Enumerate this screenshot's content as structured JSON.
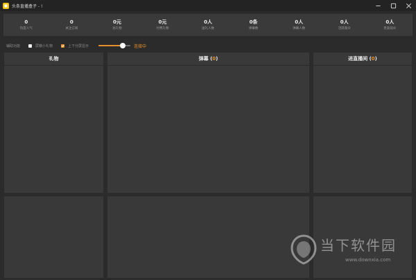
{
  "window": {
    "title": "头条直播盒子 - !"
  },
  "stats": [
    {
      "value": "0",
      "label": "热度人气"
    },
    {
      "value": "0",
      "label": "关注订阅"
    },
    {
      "value": "0元",
      "label": "总礼物"
    },
    {
      "value": "0元",
      "label": "付费礼物"
    },
    {
      "value": "0人",
      "label": "送礼人数"
    },
    {
      "value": "0条",
      "label": "弹幕数"
    },
    {
      "value": "0人",
      "label": "弹幕人数"
    },
    {
      "value": "0人",
      "label": "活跃观众"
    },
    {
      "value": "0人",
      "label": "贵族观众"
    }
  ],
  "options": {
    "assist_label": "辅助功能",
    "block_small_gift": {
      "label": "屏蔽小礼物",
      "checked": false
    },
    "split_display": {
      "label": "上下分屏显示",
      "checked": true
    },
    "slider_value_fraction": 0.75,
    "connection_status": "连接中"
  },
  "panels": {
    "gift": {
      "title": "礼物"
    },
    "danmu": {
      "title": "弹幕",
      "count": "0"
    },
    "enter": {
      "title": "进直播间",
      "count": "0"
    }
  },
  "watermark": {
    "text_cn": "当下软件园",
    "url": "www.downxia.com"
  },
  "colors": {
    "accent": "#e8922c",
    "background": "#2b2b2b",
    "panel": "#393939",
    "titlebar": "#232323"
  }
}
